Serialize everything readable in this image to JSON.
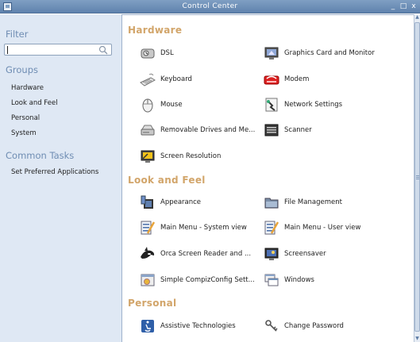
{
  "window": {
    "title": "Control Center",
    "minimize_label": "_",
    "maximize_label": "□",
    "close_label": "x"
  },
  "sidebar": {
    "filter_heading": "Filter",
    "search_value": "",
    "groups_heading": "Groups",
    "groups": [
      "Hardware",
      "Look and Feel",
      "Personal",
      "System"
    ],
    "common_tasks_heading": "Common Tasks",
    "tasks": [
      "Set Preferred Applications"
    ]
  },
  "main": {
    "sections": [
      {
        "title": "Hardware",
        "items": [
          {
            "label": "DSL",
            "icon": "dsl-icon"
          },
          {
            "label": "Graphics Card and Monitor",
            "icon": "monitor-icon"
          },
          {
            "label": "Keyboard",
            "icon": "keyboard-icon"
          },
          {
            "label": "Modem",
            "icon": "modem-icon"
          },
          {
            "label": "Mouse",
            "icon": "mouse-icon"
          },
          {
            "label": "Network Settings",
            "icon": "network-icon"
          },
          {
            "label": "Removable Drives and Me...",
            "icon": "drive-icon"
          },
          {
            "label": "Scanner",
            "icon": "scanner-icon"
          },
          {
            "label": "Screen Resolution",
            "icon": "screen-resolution-icon"
          }
        ]
      },
      {
        "title": "Look and Feel",
        "items": [
          {
            "label": "Appearance",
            "icon": "appearance-icon"
          },
          {
            "label": "File Management",
            "icon": "folder-icon"
          },
          {
            "label": "Main Menu - System view",
            "icon": "menu-editor-icon"
          },
          {
            "label": "Main Menu - User view",
            "icon": "menu-editor-icon"
          },
          {
            "label": "Orca Screen Reader and ...",
            "icon": "orca-icon"
          },
          {
            "label": "Screensaver",
            "icon": "screensaver-icon"
          },
          {
            "label": "Simple CompizConfig Sett...",
            "icon": "compiz-icon"
          },
          {
            "label": "Windows",
            "icon": "windows-icon"
          }
        ]
      },
      {
        "title": "Personal",
        "items": [
          {
            "label": "Assistive Technologies",
            "icon": "accessibility-icon"
          },
          {
            "label": "Change Password",
            "icon": "keys-icon"
          }
        ]
      }
    ]
  },
  "colors": {
    "titlebar": "#6f90b8",
    "sidebar_bg": "#dfe8f4",
    "sidebar_heading": "#6f8db3",
    "section_heading": "#d2a56a"
  }
}
